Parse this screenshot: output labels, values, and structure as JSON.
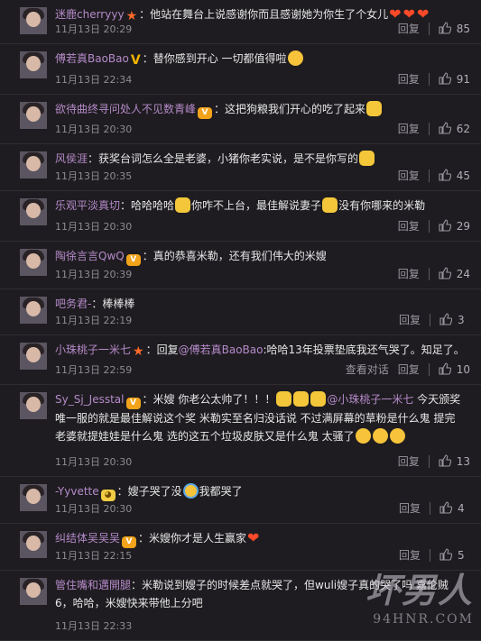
{
  "comments": [
    {
      "user": "迷鹿cherryyy",
      "badges": [
        "star"
      ],
      "colon": "：",
      "parts": [
        {
          "t": "他站在舞台上说感谢你而且感谢她为你生了个女儿"
        },
        {
          "e": "heart"
        },
        {
          "e": "heart"
        },
        {
          "e": "heart"
        }
      ],
      "time": "11月13日 20:29",
      "actions": [
        "回复"
      ],
      "likes": "85",
      "height": 49
    },
    {
      "user": "傅若真BaoBao",
      "badges": [
        "v"
      ],
      "colon": "：",
      "parts": [
        {
          "t": "替你感到开心 一切都值得啦"
        },
        {
          "e": "tongue"
        }
      ],
      "time": "11月13日 22:34",
      "actions": [
        "回复"
      ],
      "likes": "91",
      "height": 56
    },
    {
      "user": "欲待曲终寻问处人不见数青峰",
      "badges": [
        "vip"
      ],
      "colon": "：",
      "parts": [
        {
          "t": "这把狗粮我们开心的吃了起来"
        },
        {
          "e": "cat"
        }
      ],
      "time": "11月13日 20:30",
      "actions": [
        "回复"
      ],
      "likes": "62",
      "height": 55
    },
    {
      "user": "风侯涯",
      "badges": [],
      "colon": "：",
      "parts": [
        {
          "t": "获奖台词怎么全是老婆，小猪你老实说，是不是你写的"
        },
        {
          "e": "cat"
        }
      ],
      "time": "11月13日 20:35",
      "actions": [
        "回复"
      ],
      "likes": "45",
      "height": 52
    },
    {
      "user": "乐观平淡真切",
      "badges": [],
      "colon": "：",
      "parts": [
        {
          "t": "哈哈哈哈"
        },
        {
          "e": "cat"
        },
        {
          "t": "你咋不上台，最佳解说妻子"
        },
        {
          "e": "cat"
        },
        {
          "t": "没有你哪来的米勒"
        }
      ],
      "time": "11月13日 20:30",
      "actions": [
        "回复"
      ],
      "likes": "29",
      "height": 56
    },
    {
      "user": "陶徐言言QwQ",
      "badges": [
        "vip"
      ],
      "colon": "：",
      "parts": [
        {
          "t": "真的恭喜米勒，还有我们伟大的米嫂"
        }
      ],
      "time": "11月13日 20:39",
      "actions": [
        "回复"
      ],
      "likes": "24",
      "height": 53
    },
    {
      "user": "吧务君-",
      "badges": [],
      "colon": "：",
      "parts": [
        {
          "t": "棒棒棒"
        }
      ],
      "time": "11月13日 22:19",
      "actions": [
        "回复"
      ],
      "likes": "3",
      "height": 51
    },
    {
      "user": "小珠桃子一米七",
      "badges": [
        "star"
      ],
      "colon": "：",
      "parts": [
        {
          "t": "回复"
        },
        {
          "m": "@傅若真BaoBao"
        },
        {
          "t": ":哈哈13年投票垫底我还气哭了。知足了。"
        }
      ],
      "time": "11月13日 22:59",
      "actions": [
        "查看对话",
        "回复"
      ],
      "likes": "10",
      "height": 55
    },
    {
      "user": "Sy_Sj_Jesstal",
      "badges": [
        "vip"
      ],
      "colon": "：",
      "parts": [
        {
          "t": "米嫂 你老公太帅了！！！"
        },
        {
          "e": "cat"
        },
        {
          "e": "cat"
        },
        {
          "e": "cat"
        },
        {
          "m": "@小珠桃子一米七"
        },
        {
          "t": " 今天颁奖唯一服的就是最佳解说这个奖 米勒实至名归没话说 不过满屏幕的草粉是什么鬼 提完老婆就提娃娃是什么鬼 选的这五个垃圾皮肤又是什么鬼 太骚了"
        },
        {
          "e": "lol"
        },
        {
          "e": "lol"
        },
        {
          "e": "lol"
        }
      ],
      "time": "11月13日 20:30",
      "actions": [
        "回复"
      ],
      "likes": "13",
      "height": 102
    },
    {
      "user": "-Yyvette",
      "badges": [
        "cat"
      ],
      "colon": "：",
      "parts": [
        {
          "t": "嫂子哭了没"
        },
        {
          "e": "cry"
        },
        {
          "t": "我都哭了"
        }
      ],
      "time": "11月13日 20:30",
      "actions": [
        "回复"
      ],
      "likes": "4",
      "height": 52
    },
    {
      "user": "纠结体吴吴吴",
      "badges": [
        "vip"
      ],
      "colon": "：",
      "parts": [
        {
          "t": "米嫂你才是人生赢家"
        },
        {
          "e": "heart"
        }
      ],
      "time": "11月13日 22:15",
      "actions": [
        "回复"
      ],
      "likes": "5",
      "height": 52
    },
    {
      "user": "管住嘴和邁開腿",
      "badges": [],
      "colon": "：",
      "parts": [
        {
          "t": "米勒说到嫂子的时候差点就哭了，但wuli嫂子真的哭了吗 嘉伦贼6，哈哈，米嫂快来带他上分吧"
        }
      ],
      "time": "11月13日 22:33",
      "actions": [],
      "likes": "",
      "height": 78
    }
  ],
  "icons": {
    "like": "thumbs-up-icon",
    "star": "star-badge-icon",
    "v": "verified-v-icon",
    "vip": "vip-badge-icon",
    "cat": "cat-face-icon",
    "heart": "heart-emoji-icon",
    "tongue": "tongue-out-emoji-icon",
    "lol": "laughing-tears-emoji-icon",
    "cry": "crying-emoji-icon"
  },
  "colors": {
    "background": "#1e1c20",
    "username": "#b58ac9",
    "text": "#e6e6e6",
    "meta": "#8e8b92"
  },
  "watermark": {
    "main": "坏男人",
    "url": "94HNR.COM"
  }
}
